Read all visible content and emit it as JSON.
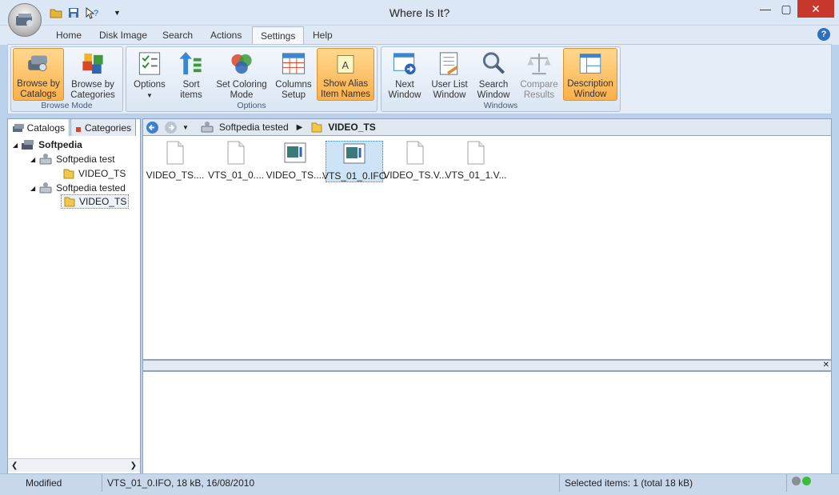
{
  "window": {
    "title": "Where Is It?"
  },
  "qat": {
    "items": [
      "open-folder",
      "save",
      "help-what",
      "customize"
    ]
  },
  "ribbon_tabs": [
    "Home",
    "Disk Image",
    "Search",
    "Actions",
    "Settings",
    "Help"
  ],
  "active_tab": "Settings",
  "groups": {
    "browse_mode": {
      "label": "Browse Mode",
      "catalogs": [
        "Browse by",
        "Catalogs"
      ],
      "categories": [
        "Browse by",
        "Categories"
      ]
    },
    "options": {
      "label": "Options",
      "options": "Options",
      "sort": [
        "Sort",
        "items"
      ],
      "coloring": [
        "Set Coloring",
        "Mode"
      ],
      "columns": [
        "Columns",
        "Setup"
      ],
      "alias": [
        "Show Alias",
        "Item Names"
      ]
    },
    "windows": {
      "label": "Windows",
      "next": [
        "Next",
        "Window"
      ],
      "userlist": [
        "User List",
        "Window"
      ],
      "search": [
        "Search",
        "Window"
      ],
      "compare": [
        "Compare",
        "Results"
      ],
      "description": [
        "Description",
        "Window"
      ]
    }
  },
  "left_tabs": [
    "Catalogs",
    "Categories"
  ],
  "tree": {
    "root": "Softpedia",
    "disk1": "Softpedia test",
    "disk1_folder": "VIDEO_TS",
    "disk2": "Softpedia tested",
    "disk2_folder": "VIDEO_TS"
  },
  "breadcrumb": [
    "Softpedia tested",
    "VIDEO_TS"
  ],
  "files": [
    "VIDEO_TS....",
    "VTS_01_0....",
    "VIDEO_TS....",
    "VTS_01_0.IFO",
    "VIDEO_TS.V...",
    "VTS_01_1.V..."
  ],
  "selected_file_index": 3,
  "status": {
    "state": "Modified",
    "file_info": "VTS_01_0.IFO, 18 kB, 16/08/2010",
    "selection": "Selected items: 1 (total 18 kB)"
  },
  "colors": {
    "accent": "#fbb049",
    "selection": "#cde4f7",
    "frame": "#b9d1ea"
  }
}
